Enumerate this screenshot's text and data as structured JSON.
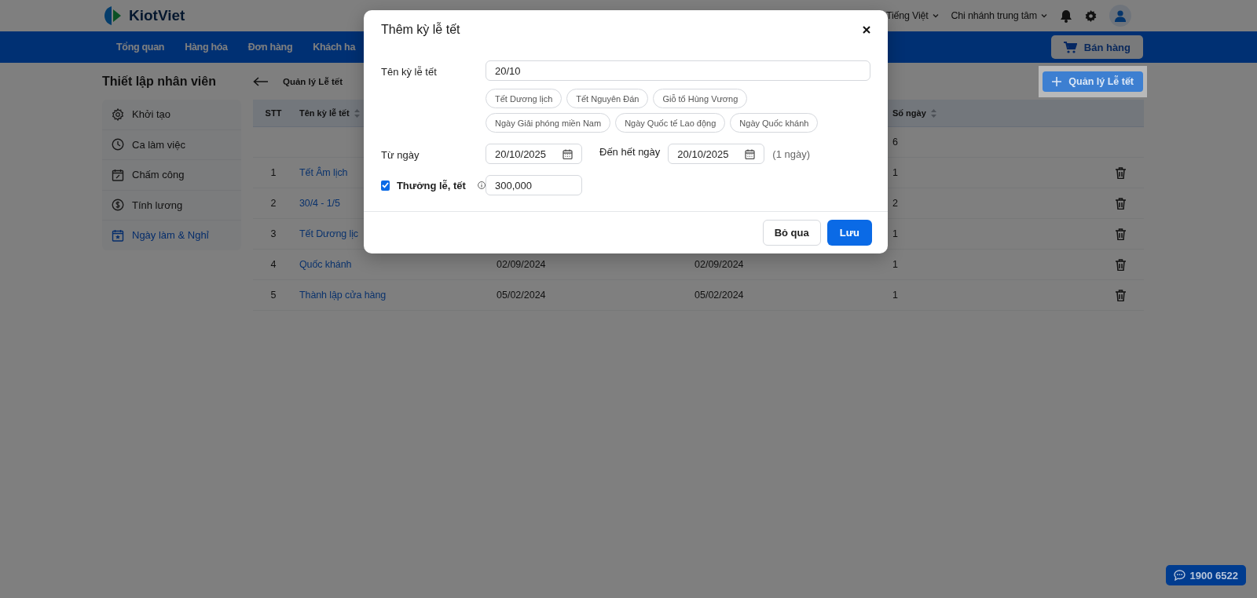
{
  "header": {
    "logo": "KiotViet",
    "language": "Tiếng Việt",
    "branch": "Chi nhánh trung tâm"
  },
  "nav": {
    "items": [
      "Tổng quan",
      "Hàng hóa",
      "Đơn hàng",
      "Khách ha"
    ],
    "sell_button": "Bán hàng"
  },
  "sidebar": {
    "title": "Thiết lập nhân viên",
    "items": [
      {
        "label": "Khởi tạo",
        "selected": false
      },
      {
        "label": "Ca làm việc",
        "selected": false
      },
      {
        "label": "Chấm công",
        "selected": false
      },
      {
        "label": "Tính lương",
        "selected": false
      },
      {
        "label": "Ngày làm & Nghỉ",
        "selected": true
      }
    ]
  },
  "page": {
    "title": "Quản lý Lễ tết",
    "add_button": "Quản lý Lễ tết"
  },
  "table": {
    "columns": [
      {
        "label": "STT",
        "sortable": false
      },
      {
        "label": "Tên kỳ lễ tết",
        "sortable": true
      },
      {
        "label": "Số ngày",
        "sortable": true
      }
    ],
    "summary": {
      "days": "6"
    },
    "rows": [
      {
        "stt": "1",
        "name": "Tết Âm lịch",
        "days": "1"
      },
      {
        "stt": "2",
        "name": "30/4 - 1/5",
        "days": "2"
      },
      {
        "stt": "3",
        "name": "Tết Dương lịc",
        "days": "1"
      },
      {
        "stt": "4",
        "name": "Quốc khánh",
        "from": "02/09/2024",
        "to": "02/09/2024",
        "days": "1"
      },
      {
        "stt": "5",
        "name": "Thành lập cửa hàng",
        "from": "05/02/2024",
        "to": "05/02/2024",
        "days": "1"
      }
    ]
  },
  "dialog": {
    "title": "Thêm kỳ lễ tết",
    "name_label": "Tên kỳ lễ tết",
    "name_value": "20/10",
    "suggestions": [
      "Tết Dương lịch",
      "Tết Nguyên Đán",
      "Giỗ tổ Hùng Vương",
      "Ngày Giải phóng miền Nam",
      "Ngày Quốc tế Lao động",
      "Ngày Quốc khánh"
    ],
    "from_label": "Từ ngày",
    "from_value": "20/10/2025",
    "to_label": "Đến hết ngày",
    "to_value": "20/10/2025",
    "duration": "(1 ngày)",
    "bonus": {
      "label": "Thưởng lễ, tết",
      "checked": true,
      "value": "300,000"
    },
    "cancel_button": "Bỏ qua",
    "save_button": "Lưu"
  },
  "chat_button": "1900 6522"
}
